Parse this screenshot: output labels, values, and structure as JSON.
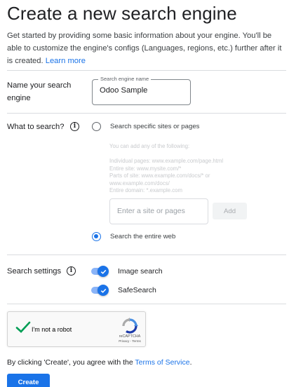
{
  "page": {
    "title": "Create a new search engine",
    "intro": "Get started by providing some basic information about your engine. You'll be able to customize the engine's configs (Languages, regions, etc.) further after it is created.",
    "learn_more": "Learn more"
  },
  "name_section": {
    "label_line1": "Name your search",
    "label_line2": "engine",
    "field_legend": "Search engine name",
    "field_value": "Odoo Sample"
  },
  "what_section": {
    "label": "What to search?",
    "option_specific": "Search specific sites or pages",
    "option_specific_selected": false,
    "helper": [
      "You can add any of the following:",
      "",
      "Individual pages: www.example.com/page.html",
      "Entire site: www.mysite.com/*",
      "Parts of site: www.example.com/docs/* or",
      "www.example.com/docs/",
      "Entire domain: *.example.com"
    ],
    "site_placeholder": "Enter a site or pages",
    "add_label": "Add",
    "option_entire": "Search the entire web",
    "option_entire_selected": true
  },
  "settings_section": {
    "label": "Search settings",
    "image_search": "Image search",
    "image_search_on": true,
    "safesearch": "SafeSearch",
    "safesearch_on": true
  },
  "captcha": {
    "label": "I'm not a robot",
    "brand": "reCAPTCHA",
    "links": "Privacy - Terms",
    "checked": true
  },
  "footer": {
    "terms_prefix": "By clicking 'Create', you agree with the ",
    "terms_link": "Terms of Service",
    "terms_suffix": ".",
    "create_label": "Create"
  },
  "colors": {
    "accent": "#1a73e8",
    "check_green": "#009e55"
  }
}
